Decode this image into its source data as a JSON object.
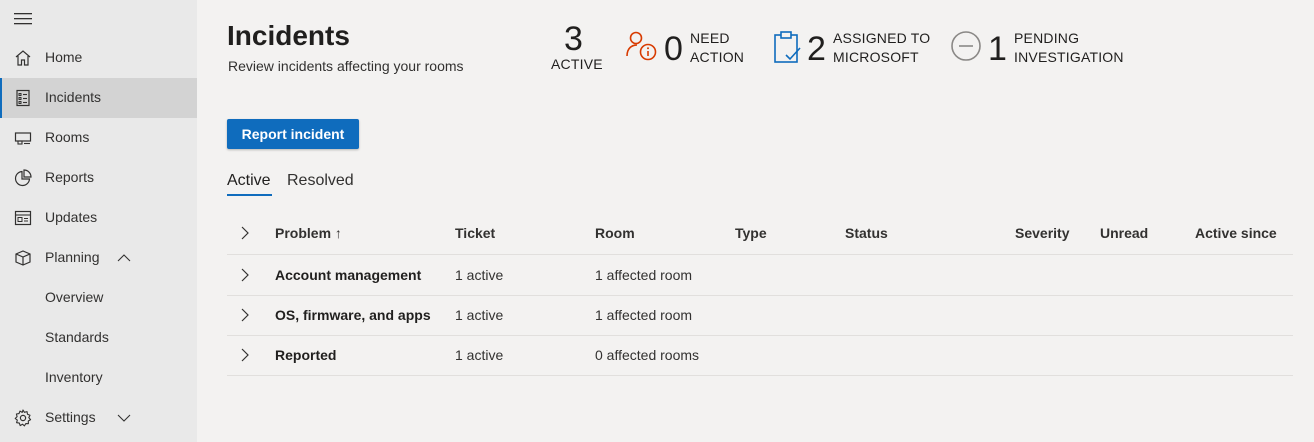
{
  "sidebar": {
    "items": [
      {
        "label": "Home",
        "icon": "home-icon"
      },
      {
        "label": "Incidents",
        "icon": "incidents-icon",
        "selected": true
      },
      {
        "label": "Rooms",
        "icon": "rooms-icon"
      },
      {
        "label": "Reports",
        "icon": "pie-chart-icon"
      },
      {
        "label": "Updates",
        "icon": "updates-icon"
      },
      {
        "label": "Planning",
        "icon": "package-icon",
        "expanded": true
      },
      {
        "label": "Overview"
      },
      {
        "label": "Standards"
      },
      {
        "label": "Inventory"
      },
      {
        "label": "Settings",
        "icon": "gear-icon",
        "expanded": false
      }
    ]
  },
  "header": {
    "title": "Incidents",
    "subtitle": "Review incidents affecting your rooms"
  },
  "stats": {
    "active": {
      "value": "3",
      "label": "ACTIVE"
    },
    "need_action": {
      "value": "0",
      "label_line1": "NEED",
      "label_line2": "ACTION"
    },
    "assigned": {
      "value": "2",
      "label_line1": "ASSIGNED TO",
      "label_line2": "MICROSOFT"
    },
    "pending": {
      "value": "1",
      "label_line1": "PENDING",
      "label_line2": "INVESTIGATION"
    }
  },
  "actions": {
    "report_label": "Report incident"
  },
  "tabs": [
    {
      "label": "Active",
      "selected": true
    },
    {
      "label": "Resolved",
      "selected": false
    }
  ],
  "table": {
    "columns": [
      "Problem ↑",
      "Ticket",
      "Room",
      "Type",
      "Status",
      "Severity",
      "Unread",
      "Active since"
    ],
    "rows": [
      {
        "problem": "Account management",
        "ticket": "1 active",
        "room": "1 affected room"
      },
      {
        "problem": "OS, firmware, and apps",
        "ticket": "1 active",
        "room": "1 affected room"
      },
      {
        "problem": "Reported",
        "ticket": "1 active",
        "room": "0 affected rooms"
      }
    ]
  },
  "colors": {
    "accent": "#0f6cbd",
    "alert": "#d83b01",
    "sidebar_bg": "#e9e9e9",
    "page_bg": "#f3f2f1"
  }
}
